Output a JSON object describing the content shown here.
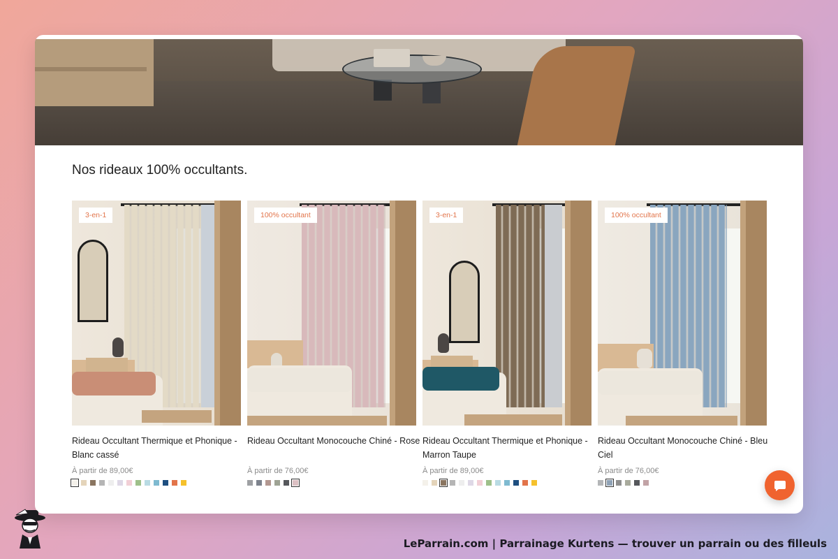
{
  "section": {
    "title": "Nos rideaux 100% occultants."
  },
  "products": [
    {
      "badge": "3-en-1",
      "name": "Rideau Occultant Thermique et Phonique - Blanc cassé",
      "price": "À partir de 89,00€",
      "curtain_color": "#e3dac6",
      "duvet_color": "#c98e76",
      "swatches": [
        "#f4f1ea",
        "#e4d4ba",
        "#8a7560",
        "#b5b5b5",
        "#eeeeee",
        "#ded8e6",
        "#f2cfd6",
        "#9ec08a",
        "#b9dbe3",
        "#7fbad0",
        "#1e4f80",
        "#e2744a",
        "#f5c12c"
      ],
      "selected_swatch": 0
    },
    {
      "badge": "100% occultant",
      "name": "Rideau Occultant Monocouche Chiné - Rose",
      "price": "À partir de 76,00€",
      "curtain_color": "#d8b9bb",
      "duvet_color": "#ece7dd",
      "swatches": [
        "#9ea0a3",
        "#7d838d",
        "#b39891",
        "#9ea394",
        "#56585c",
        "#dcc0c3"
      ],
      "selected_swatch": 5
    },
    {
      "badge": "3-en-1",
      "name": "Rideau Occultant Thermique et Phonique - Marron Taupe",
      "price": "À partir de 89,00€",
      "curtain_color": "#7e6b55",
      "duvet_color": "#1f5866",
      "swatches": [
        "#f4f1ea",
        "#e4d4ba",
        "#8a7560",
        "#b5b5b5",
        "#eeeeee",
        "#ded8e6",
        "#f2cfd6",
        "#9ec08a",
        "#b9dbe3",
        "#7fbad0",
        "#1e4f80",
        "#e2744a",
        "#f5c12c"
      ],
      "selected_swatch": 2
    },
    {
      "badge": "100% occultant",
      "name": "Rideau Occultant Monocouche Chiné - Bleu Ciel",
      "price": "À partir de 76,00€",
      "curtain_color": "#8aa6bf",
      "duvet_color": "#ece7dd",
      "swatches": [
        "#b4b6b8",
        "#8fa2b6",
        "#8f8f8f",
        "#a9ab9d",
        "#56585c",
        "#c2a3a6"
      ],
      "selected_swatch": 1
    }
  ],
  "chat": {
    "icon": "chat-bubble-icon",
    "color": "#f0632f"
  },
  "footer": {
    "text": "LeParrain.com | Parrainage Kurtens — trouver un parrain ou des filleuls",
    "logo": "spy-mascot-logo"
  }
}
